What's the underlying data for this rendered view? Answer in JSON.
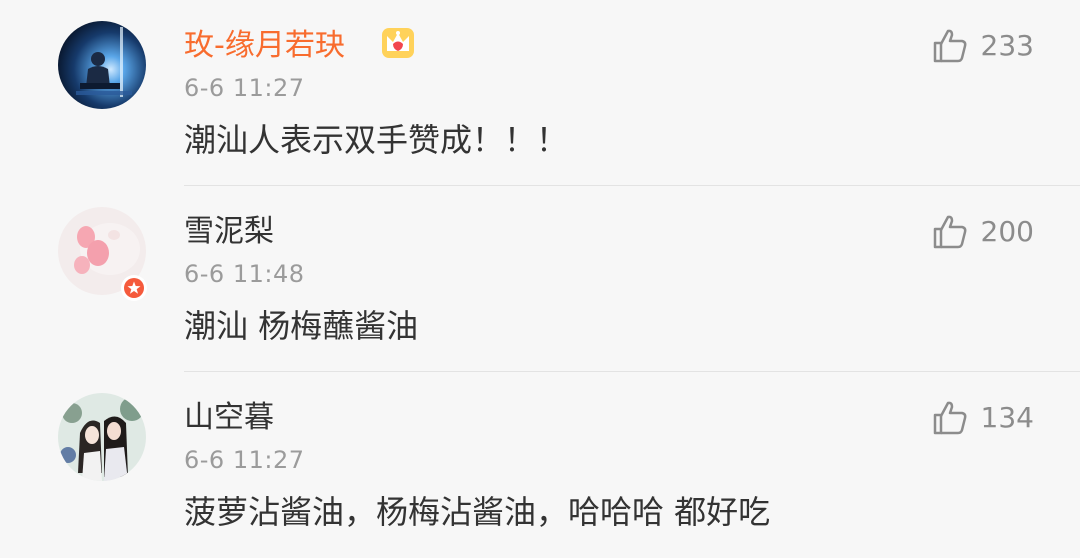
{
  "comments": [
    {
      "username": "玫-缘月若玦",
      "vip": true,
      "time": "6-6 11:27",
      "text": "潮汕人表示双手赞成！！！",
      "likes": "233",
      "avatar_icon": "stage-performer-avatar",
      "badge_icon": "crown-icon"
    },
    {
      "username": "雪泥梨",
      "vip": false,
      "time": "6-6 11:48",
      "text": "潮汕 杨梅蘸酱油",
      "likes": "200",
      "avatar_icon": "pink-cat-paw-avatar",
      "badge_icon": "verified-badge-icon"
    },
    {
      "username": "山空暮",
      "vip": false,
      "time": "6-6 11:27",
      "text": "菠萝沾酱油，杨梅沾酱油，哈哈哈 都好吃",
      "likes": "134",
      "avatar_icon": "anime-couple-avatar"
    }
  ],
  "colors": {
    "background": "#f7f7f7",
    "vip_name": "#f86c2e",
    "name": "#333333",
    "meta": "#9b9b9b",
    "like": "#8c8c8c",
    "badge": "#f55a3c"
  }
}
